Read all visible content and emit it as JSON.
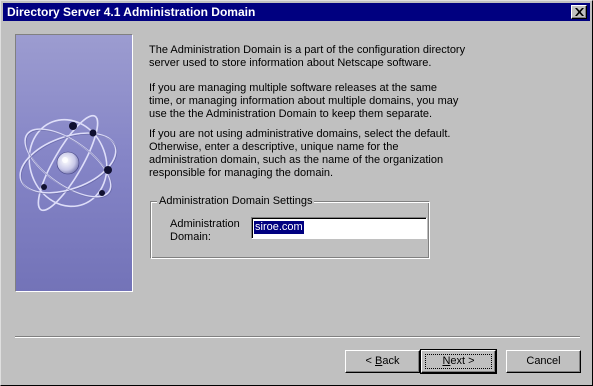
{
  "window": {
    "title": "Directory Server 4.1 Administration Domain",
    "close_icon": "close-icon"
  },
  "intro": {
    "paragraphs": [
      {
        "lines": [
          "The Administration Domain is a part of the configuration directory",
          "server used to store information about Netscape software."
        ]
      },
      {
        "lines": [
          "If you are managing multiple software releases at the same",
          "time, or managing information about multiple domains, you may",
          "use the the Administration Domain to keep them separate."
        ]
      },
      {
        "lines": [
          "If you are not using administrative domains, select the default.",
          "Otherwise, enter a descriptive, unique name for the",
          "administration domain, such as the name of the organization",
          "responsible for managing the domain."
        ]
      }
    ]
  },
  "settings": {
    "group_title": "Administration Domain Settings",
    "field_label_line1": "Administration",
    "field_label_line2": "Domain:",
    "field_value": "siroe.com"
  },
  "buttons": {
    "back": {
      "label": "< Back",
      "mnemonic_prefix": "< ",
      "mnemonic_char": "B",
      "rest": "ack"
    },
    "next": {
      "label": "Next >",
      "mnemonic_char": "N",
      "rest": "ext >"
    },
    "cancel": {
      "label": "Cancel"
    }
  },
  "colors": {
    "dialog_bg": "#c0c0c0",
    "titlebar": "#000080",
    "side_panel": "#8484c6",
    "selection": "#000080"
  },
  "icons": [
    "close-icon",
    "orbit-logo-icon"
  ]
}
